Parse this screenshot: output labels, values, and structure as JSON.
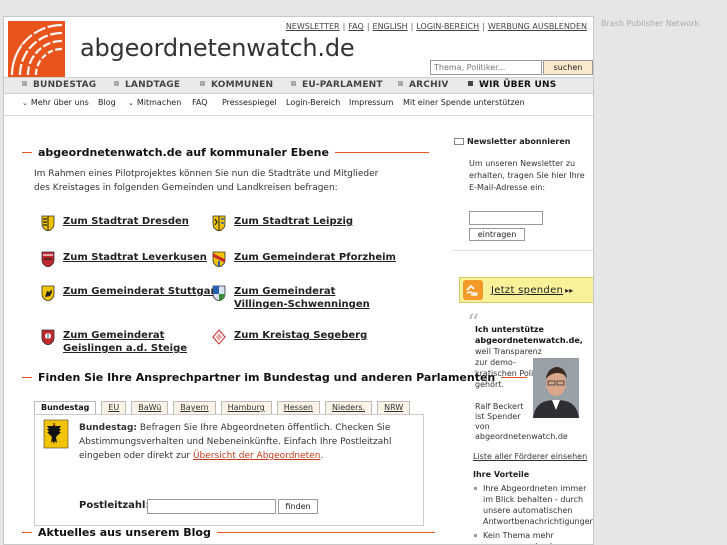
{
  "side_note": "Brash Publisher Network",
  "header": {
    "title": "abgeordnetenwatch.de",
    "toplinks": [
      "NEWSLETTER",
      "FAQ",
      "ENGLISH",
      "LOGIN-BEREICH",
      "WERBUNG AUSBLENDEN"
    ],
    "search_placeholder": "Thema, Politiker...",
    "search_button": "suchen"
  },
  "mainnav": [
    "BUNDESTAG",
    "LANDTAGE",
    "KOMMUNEN",
    "EU-PARLAMENT",
    "ARCHIV",
    "WIR ÜBER UNS"
  ],
  "subnav": [
    "Mehr über uns",
    "Blog",
    "Mitmachen",
    "FAQ",
    "Pressespiegel",
    "Login-Bereich",
    "Impressum",
    "Mit einer Spende unterstützen"
  ],
  "kommunal": {
    "heading": "abgeordnetenwatch.de auf kommunaler Ebene",
    "intro": "Im Rahmen eines Pilotprojektes können Sie nun die Stadträte und Mitglieder des Kreistages in folgenden Gemeinden und Landkreisen befragen:",
    "links": [
      "Zum Stadtrat Dresden",
      "Zum Stadtrat Leipzig",
      "Zum Stadtrat Leverkusen",
      "Zum Gemeinderat Pforzheim",
      "Zum Gemeinderat Stuttgart",
      "Zum Gemeinderat Villingen-Schwenningen",
      "Zum Gemeinderat Geislingen a.d. Steige",
      "Zum Kreistag Segeberg"
    ]
  },
  "finder": {
    "heading": "Finden Sie Ihre Ansprechpartner im Bundestag und anderen Parlamenten",
    "tabs": [
      "Bundestag",
      "EU",
      "BaWü",
      "Bayern",
      "Hamburg",
      "Hessen",
      "Nieders.",
      "NRW"
    ],
    "desc_bold": "Bundestag:",
    "desc": " Befragen Sie Ihre Abgeordneten öffentlich. Checken Sie Abstimmungsverhalten und Nebeneinkünfte. Einfach Ihre Postleitzahl eingeben oder direkt zur ",
    "desc_link": "Übersicht der Abgeordneten",
    "desc_end": ".",
    "plz_label": "Postleitzahl:",
    "plz_button": "finden"
  },
  "blog": {
    "heading": "Aktuelles aus unserem Blog"
  },
  "sidebar": {
    "newsletter_title": "Newsletter abonnieren",
    "newsletter_text": "Um unseren Newsletter zu erhalten, tragen Sie hier Ihre E-Mail-Adresse ein:",
    "newsletter_button": "eintragen",
    "donate": "Jetzt spenden",
    "donate_arrows": "▸▸",
    "quote_bold": "Ich unterstütze abgeordnetenwatch.de,",
    "quote_rest": "weil Transparenz zur demo-kratischen Politik gehört.",
    "attrib_name": "Ralf Beckert",
    "attrib_1": "ist Spender",
    "attrib_2": "von abgeordnetenwatch.de",
    "all_supporters": "Liste aller Förderer einsehen",
    "vorteile_title": "Ihre Vorteile",
    "vorteile": [
      "Ihre Abgeordneten immer im Blick behalten - durch unsere automatischen Antwortbenachrichtigungen",
      "Kein Thema mehr verpassen - durch unsere Themen-Abo-Funktion"
    ]
  },
  "colors": {
    "accent": "#e8541b",
    "donate_bg": "#f7f19a",
    "link_red": "#c23a1a"
  }
}
